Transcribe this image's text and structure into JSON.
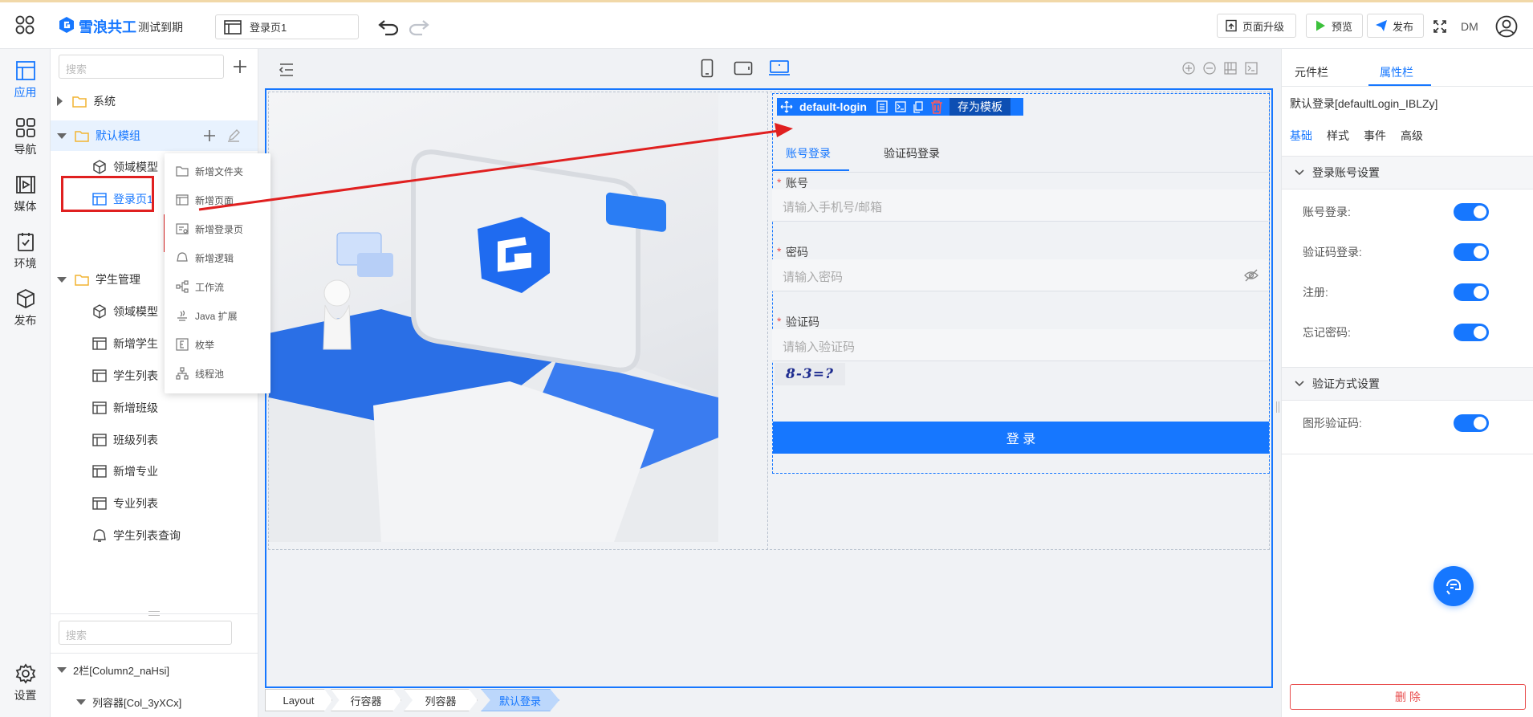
{
  "topbar": {
    "brand": "雪浪共工",
    "subtitle": "测试到期",
    "page_name": "登录页1",
    "upgrade_label": "页面升级",
    "preview_label": "预览",
    "publish_label": "发布",
    "user_initials": "DM"
  },
  "rail": {
    "items": [
      {
        "label": "应用",
        "icon": "app-icon"
      },
      {
        "label": "导航",
        "icon": "grid-icon"
      },
      {
        "label": "媒体",
        "icon": "media-icon"
      },
      {
        "label": "环境",
        "icon": "env-icon"
      },
      {
        "label": "发布",
        "icon": "cube-icon"
      }
    ],
    "settings_label": "设置"
  },
  "tree": {
    "search_placeholder": "搜索",
    "rows": [
      {
        "label": "系统"
      },
      {
        "label": "默认模组"
      },
      {
        "label": "领域模型"
      },
      {
        "label": "登录页1"
      },
      {
        "label": "学生管理"
      },
      {
        "label": "领域模型"
      },
      {
        "label": "新增学生"
      },
      {
        "label": "学生列表"
      },
      {
        "label": "新增班级"
      },
      {
        "label": "班级列表"
      },
      {
        "label": "新增专业"
      },
      {
        "label": "专业列表"
      },
      {
        "label": "学生列表查询"
      }
    ],
    "bottom_search_placeholder": "搜索",
    "outline": [
      "2栏[Column2_naHsi]",
      "列容器[Col_3yXCx]"
    ]
  },
  "context_menu": {
    "items": [
      "新增文件夹",
      "新增页面",
      "新增登录页",
      "新增逻辑",
      "工作流",
      "Java 扩展",
      "枚举",
      "线程池"
    ]
  },
  "canvas": {
    "component_tag": "default-login",
    "save_template_label": "存为模板",
    "tabs": [
      "账号登录",
      "验证码登录"
    ],
    "account_label": "账号",
    "account_placeholder": "请输入手机号/邮箱",
    "password_label": "密码",
    "password_placeholder": "请输入密码",
    "captcha_label": "验证码",
    "captcha_placeholder": "请输入验证码",
    "captcha_image_text": "8-3=?",
    "login_button": "登 录",
    "required_mark": "*"
  },
  "breadcrumbs": [
    "Layout",
    "行容器",
    "列容器",
    "默认登录"
  ],
  "right_panel": {
    "tabs": [
      "元件栏",
      "属性栏"
    ],
    "component_title": "默认登录[defaultLogin_IBLZy]",
    "subtabs": [
      "基础",
      "样式",
      "事件",
      "高级"
    ],
    "section1_title": "登录账号设置",
    "section1_rows": [
      {
        "label": "账号登录:",
        "on": true
      },
      {
        "label": "验证码登录:",
        "on": true
      },
      {
        "label": "注册:",
        "on": true
      },
      {
        "label": "忘记密码:",
        "on": true
      }
    ],
    "section2_title": "验证方式设置",
    "section2_rows": [
      {
        "label": "图形验证码:",
        "on": true
      }
    ],
    "delete_label": "删 除"
  },
  "colors": {
    "accent": "#1677ff",
    "highlight_red": "#e02020",
    "danger": "#e84c4c"
  }
}
